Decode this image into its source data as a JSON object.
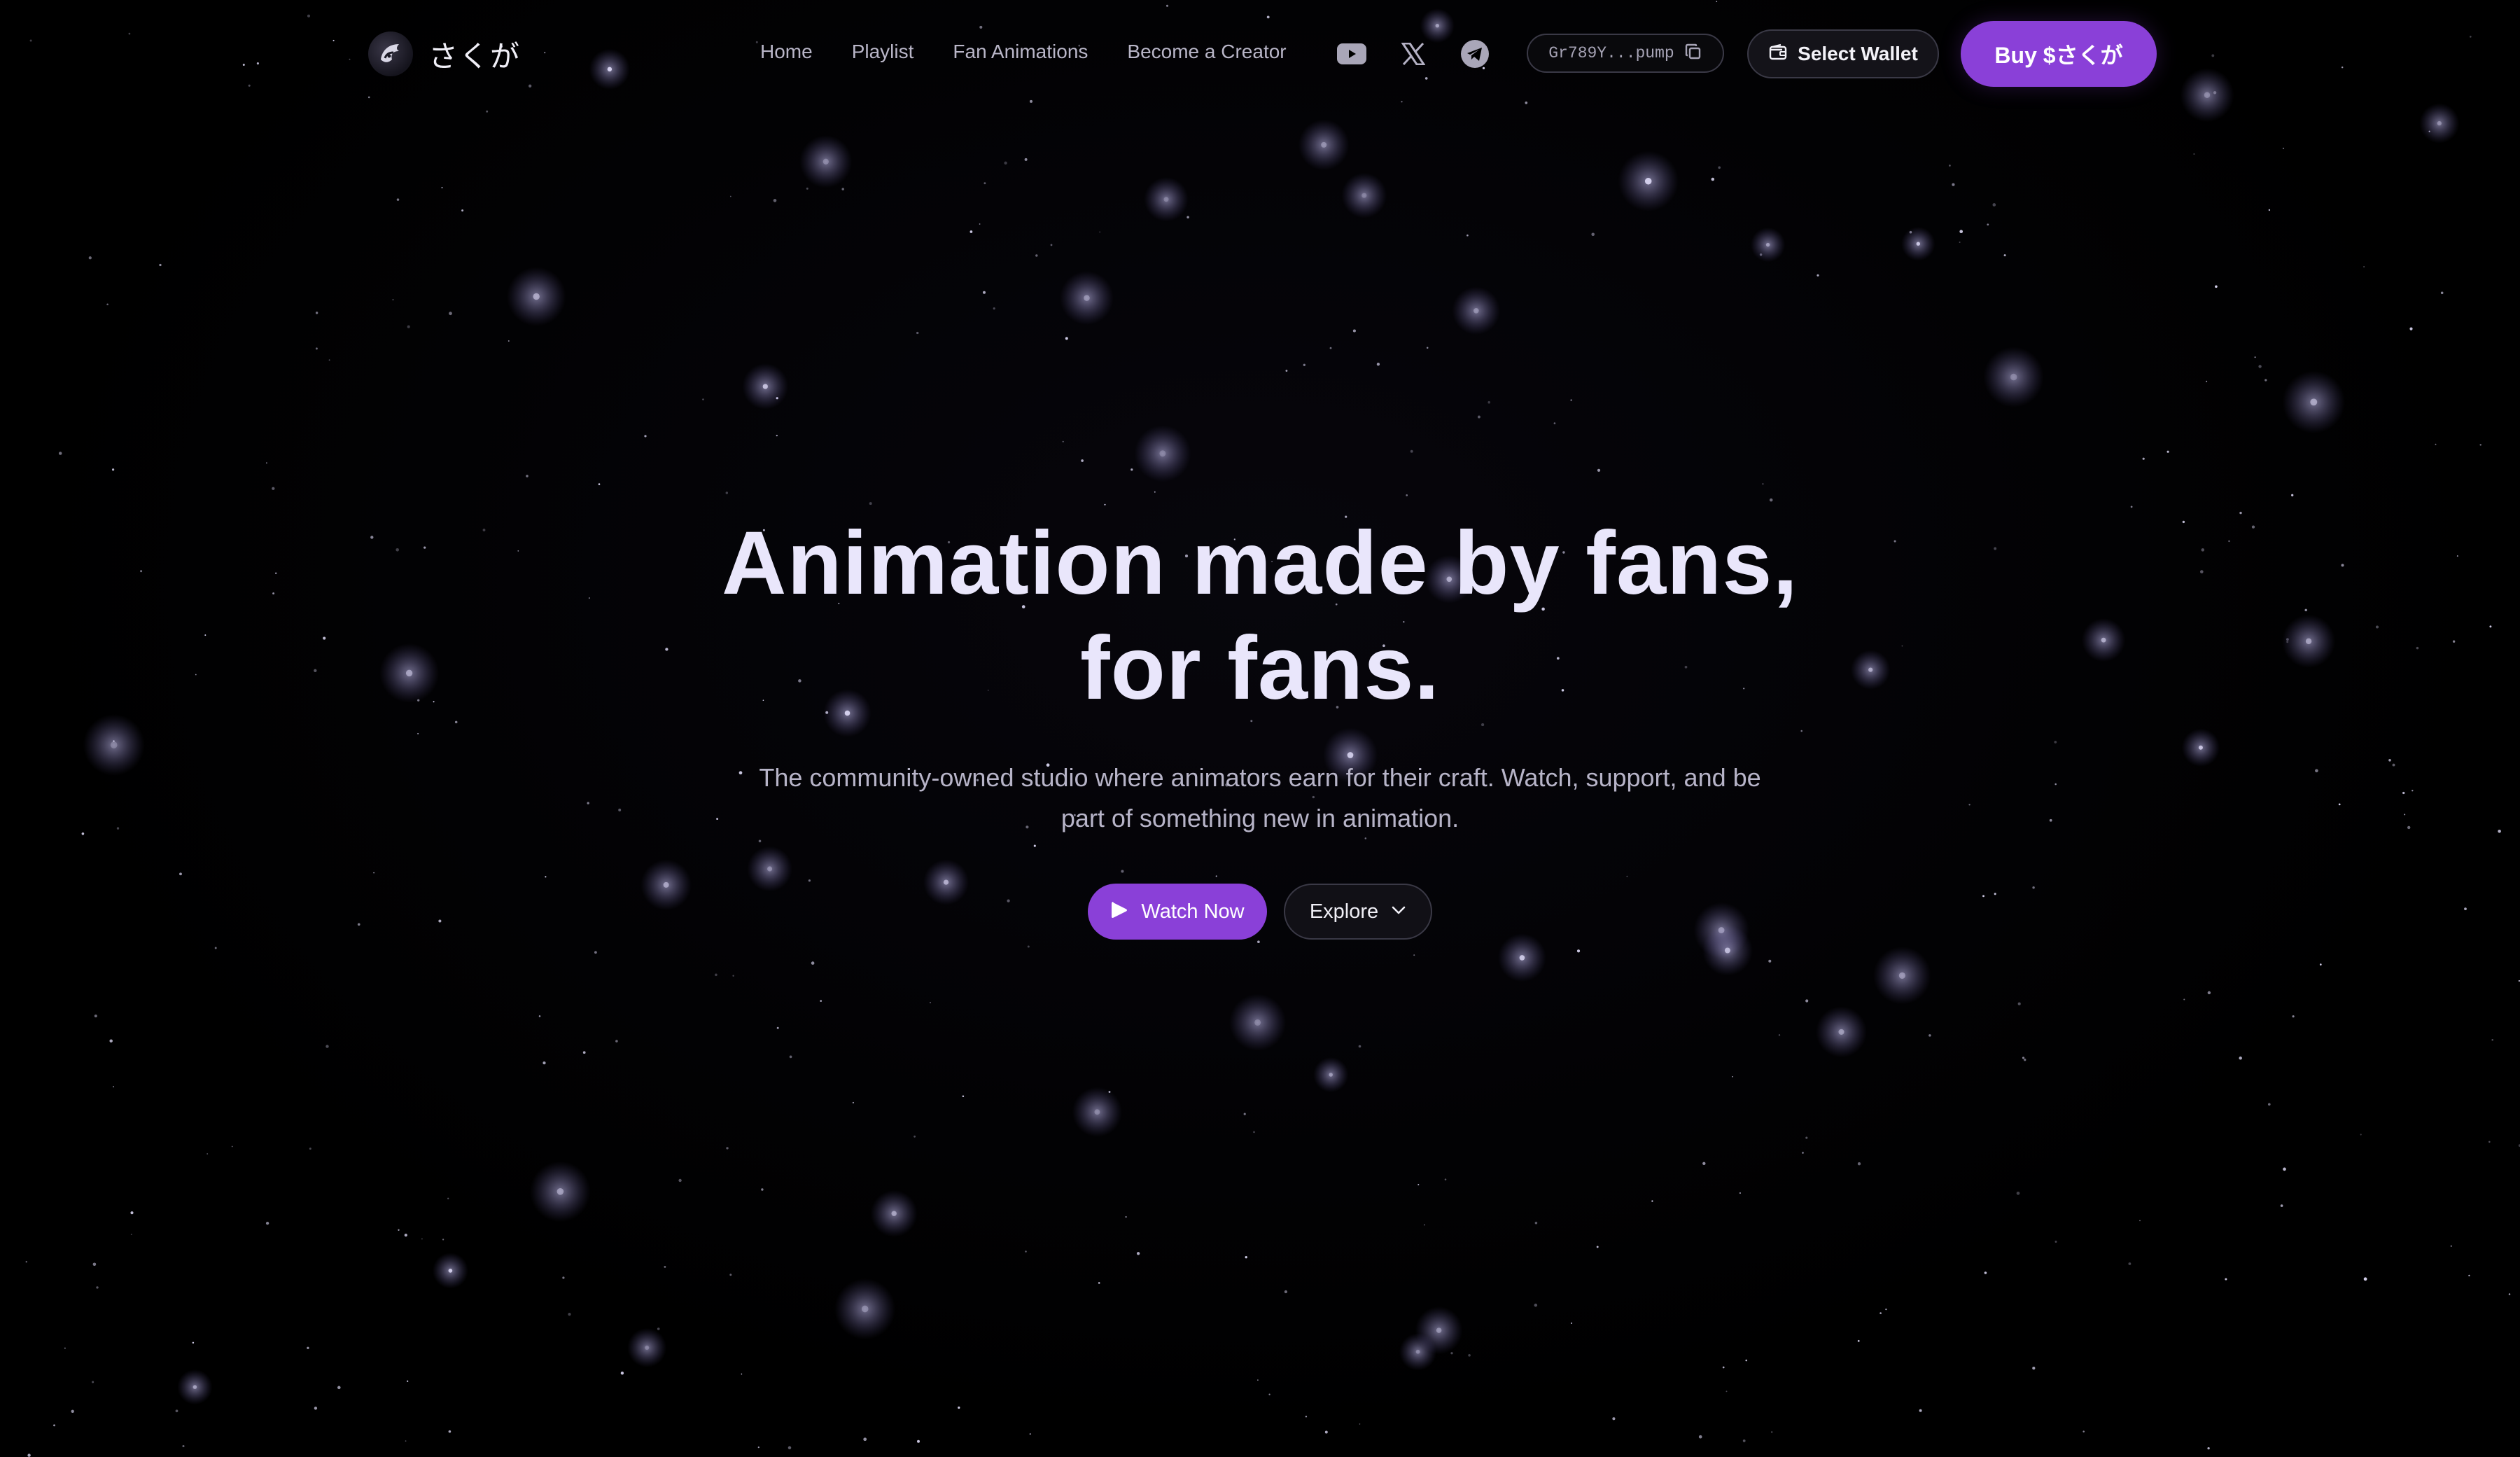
{
  "brand": {
    "name": "さくが",
    "logo_icon": "anime-character-logo-icon"
  },
  "nav": {
    "links": [
      {
        "label": "Home"
      },
      {
        "label": "Playlist"
      },
      {
        "label": "Fan Animations"
      },
      {
        "label": "Become a Creator"
      }
    ],
    "socials": [
      {
        "icon": "youtube-icon"
      },
      {
        "icon": "x-icon"
      },
      {
        "icon": "telegram-icon"
      }
    ],
    "contract": {
      "address_short": "Gr789Y...pump",
      "copy_icon": "copy-icon"
    },
    "wallet": {
      "label": "Select Wallet",
      "icon": "wallet-icon"
    },
    "buy": {
      "label": "Buy $さくが"
    }
  },
  "hero": {
    "title_line1": "Animation made by fans,",
    "title_line2": "for fans.",
    "subtitle": "The community-owned studio where animators earn for their craft. Watch, support, and be part of something new in animation.",
    "primary_action": {
      "label": "Watch Now",
      "icon": "play-icon"
    },
    "secondary_action": {
      "label": "Explore",
      "icon": "chevron-down-icon"
    }
  },
  "theme": {
    "background": "#000000",
    "accent": "#8a40d8",
    "text": "#e9e6fb",
    "muted_text": "#b7b4c8"
  }
}
